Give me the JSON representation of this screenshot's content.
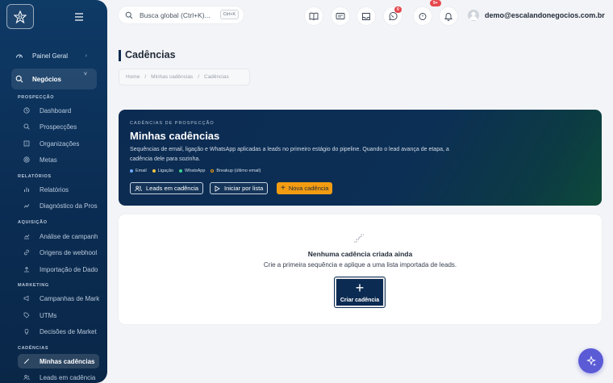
{
  "sidebar": {
    "top": [
      {
        "label": "Painel Geral",
        "icon": "dashboard-gauge-icon",
        "chevron": "›"
      },
      {
        "label": "Negócios",
        "icon": "search-icon",
        "chevron": "˅"
      }
    ],
    "sections": {
      "prospeccao": "PROSPECÇÃO",
      "relatorios": "RELATÓRIOS",
      "aquisicao": "AQUISIÇÃO",
      "marketing": "MARKETING",
      "cadencias": "CADÊNCIAS"
    },
    "items": {
      "dashboard": "Dashboard",
      "prospeccoes": "Prospecções",
      "organizacoes": "Organizações",
      "metas": "Metas",
      "relatorios": "Relatórios",
      "diagnostico": "Diagnóstico da Pros",
      "analise": "Análise de campanh",
      "origens": "Origens de webhool",
      "importacao": "Importação de Dado",
      "campanhas": "Campanhas de Mark",
      "utms": "UTMs",
      "decisoes": "Decisões de Market",
      "minhas": "Minhas cadências",
      "leads": "Leads em cadência"
    }
  },
  "topbar": {
    "search_placeholder": "Busca global (Ctrl+K)...",
    "search_shortcut": "Ctrl+K",
    "whatsapp_badge": "0",
    "alerts_badge": "9+",
    "user_email": "demo@escalandonegocios.com.br"
  },
  "page": {
    "title": "Cadências",
    "breadcrumb": [
      "Home",
      "Minhas cadências",
      "Cadências"
    ]
  },
  "hero": {
    "eyebrow": "CADÊNCIAS DE PROSPECÇÃO",
    "title": "Minhas cadências",
    "description": "Sequências de email, ligação e WhatsApp aplicadas a leads no primeiro estágio do pipeline. Quando o lead avança de etapa, a cadência dele para sozinha.",
    "legend": [
      {
        "label": "Email",
        "color": "#6ea8ff"
      },
      {
        "label": "Ligação",
        "color": "#f5c542"
      },
      {
        "label": "WhatsApp",
        "color": "#3ecf8e"
      },
      {
        "label": "Breakup (último email)",
        "color": "#f59e0b"
      }
    ],
    "buttons": {
      "leads": "Leads em cadência",
      "iniciar": "Iniciar por lista",
      "nova": "Nova cadência"
    }
  },
  "empty_state": {
    "title": "Nenhuma cadência criada ainda",
    "subtitle": "Crie a primeira sequência e aplique a uma lista importada de leads.",
    "button": "Criar cadência"
  },
  "colors": {
    "sidebar": "#0b2c52",
    "accent_orange": "#f39c12",
    "fab": "#5b5bd6",
    "badge": "#e5484d"
  }
}
